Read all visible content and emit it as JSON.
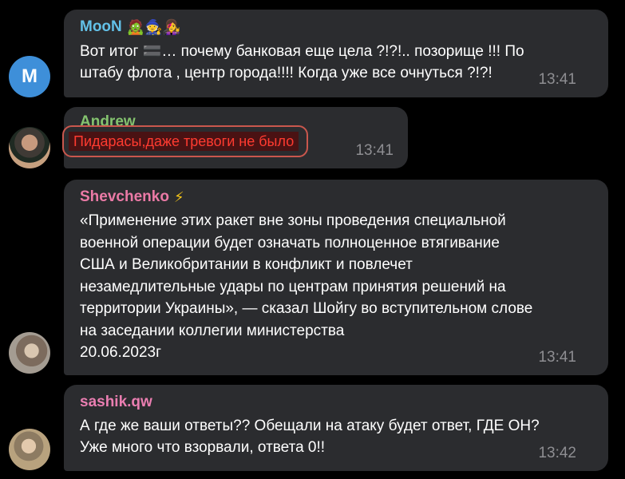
{
  "messages": [
    {
      "sender": "MooN",
      "sender_emoji": "🧟🧙👩‍🎤",
      "avatar_letter": "M",
      "text": "Вот итог 🟰… почему банковая еще цела ?!?!.. позорище !!! По\nштабу флота , центр города!!!! Когда уже все очнуться ?!?!",
      "time": "13:41"
    },
    {
      "sender": "Andrew",
      "text": "Пидарасы,даже тревоги не было",
      "time": "13:41"
    },
    {
      "sender": "Shevchenko",
      "sender_emoji": "⚡",
      "text": "«Применение этих ракет вне зоны проведения специальной\nвоенной операции будет означать полноценное втягивание\nСША и Великобритании в конфликт и повлечет\nнезамедлительные удары по центрам принятия решений на\nтерритории Украины», — сказал Шойгу во вступительном слове\nна заседании коллегии министерства\n20.06.2023г",
      "time": "13:41"
    },
    {
      "sender": "sashik.qw",
      "text": "А где же ваши ответы?? Обещали на атаку будет ответ, ГДЕ ОН?\nУже много что взорвали, ответа 0!!",
      "time": "13:42"
    }
  ],
  "colors": {
    "background": "#000000",
    "bubble": "#2b2c2f",
    "highlight_text": "#ff3b30",
    "highlight_border": "#c9574d"
  }
}
